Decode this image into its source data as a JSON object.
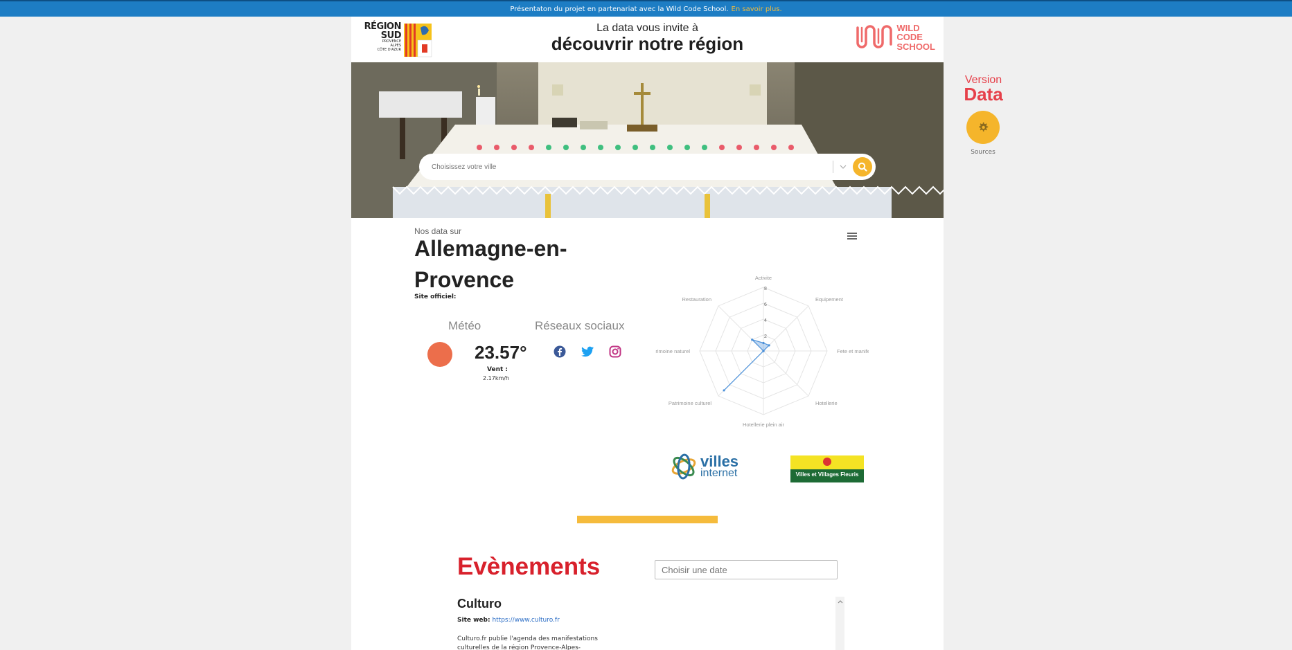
{
  "banner": {
    "text": "Présentaton du projet en partenariat avec la Wild Code School.",
    "link": "En savoir plus."
  },
  "header": {
    "region_logo": {
      "line1": "RÉGION",
      "line2": "SUD",
      "small": [
        "PROVENCE",
        "ALPES",
        "CÔTE D'AZUR"
      ]
    },
    "tagline": "La data vous invite à",
    "title": "découvrir notre région",
    "wcs_logo": [
      "WILD",
      "CODE",
      "SCHOOL"
    ]
  },
  "search": {
    "placeholder": "Choisissez votre ville"
  },
  "data_section": {
    "intro": "Nos data sur",
    "city_line1": "Allemagne-en-",
    "city_line2": "Provence",
    "site_label": "Site officiel:"
  },
  "weather": {
    "title": "Météo",
    "temperature": "23.57°",
    "wind_label": "Vent :",
    "wind_value": "2.17km/h"
  },
  "social": {
    "title": "Réseaux sociaux",
    "icons": [
      "facebook-icon",
      "twitter-icon",
      "instagram-icon"
    ]
  },
  "chart_data": {
    "type": "radar",
    "axes": [
      "Activite",
      "Equipement",
      "Fete et manifestation",
      "Hotellerie",
      "Hotellerie plein air",
      "Patrimoine culturel",
      "Patrimoine naturel",
      "Restauration"
    ],
    "axis_display_labels": [
      "Activite",
      "Equipement",
      "Fete et manife",
      "Hotellerie",
      "Hotellerie plein air",
      "Patrimoine culturel",
      "rimoine naturel",
      "Restauration"
    ],
    "ticks": [
      "2",
      "4",
      "6",
      "8"
    ],
    "rmax": 8,
    "series": [
      {
        "values": [
          1,
          1,
          0,
          0,
          0,
          7,
          0,
          2
        ],
        "color": "#4a90d9"
      }
    ]
  },
  "badges": {
    "villes_internet": [
      "villes",
      "internet"
    ],
    "villes_fleuris": "Villes et Villages Fleuris"
  },
  "events": {
    "title": "Evènements",
    "date_placeholder": "Choisir une date",
    "items": [
      {
        "name": "Culturo",
        "web_label": "Site web:",
        "url": "https://www.culturo.fr",
        "description": "Culturo.fr publie l'agenda des manifestations culturelles de la région Provence-Alpes-"
      }
    ]
  },
  "sidebar": {
    "version_line1": "Version",
    "version_line2": "Data",
    "sources_label": "Sources"
  },
  "colors": {
    "banner": "#1d7dc4",
    "accent_yellow": "#f5b52b",
    "accent_red": "#d8212c",
    "sun": "#ec6e4b"
  }
}
